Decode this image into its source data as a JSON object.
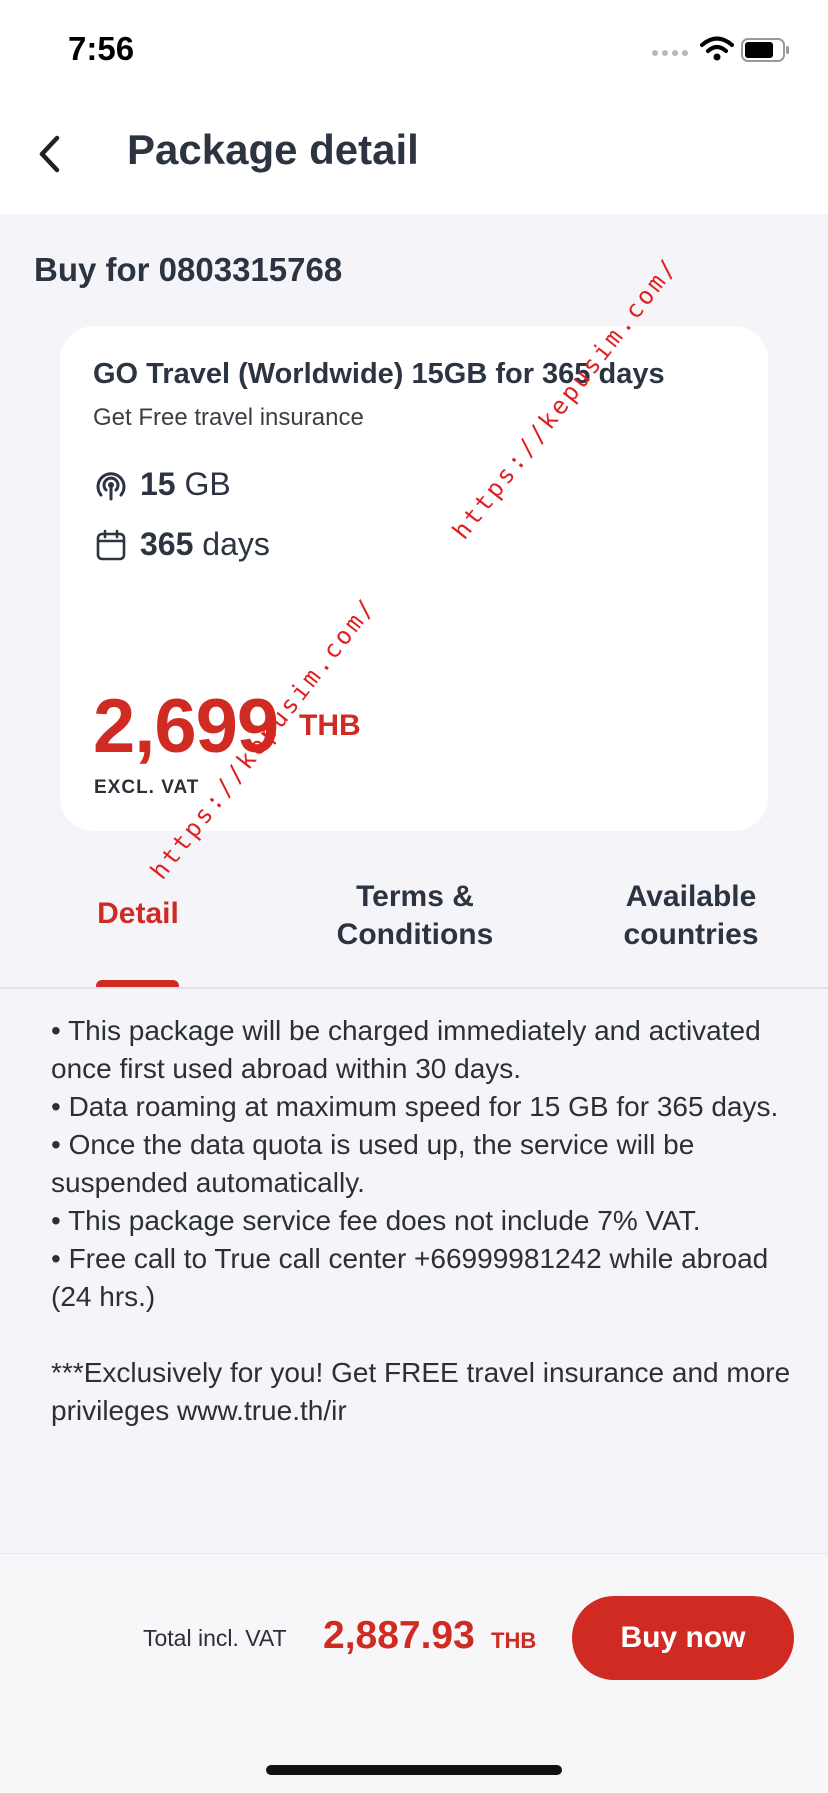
{
  "status_bar": {
    "time": "7:56"
  },
  "header": {
    "title": "Package detail"
  },
  "buy_for": "Buy for 0803315768",
  "package": {
    "name": "GO Travel (Worldwide) 15GB for 365 days",
    "subtitle": "Get Free travel insurance",
    "data_value": "15",
    "data_unit": "GB",
    "days_value": "365",
    "days_unit": "days",
    "price": "2,699",
    "currency": "THB",
    "vat_note": "EXCL. VAT"
  },
  "tabs": [
    {
      "label": "Detail",
      "active": true
    },
    {
      "label_line1": "Terms &",
      "label_line2": "Conditions",
      "active": false
    },
    {
      "label_line1": "Available",
      "label_line2": "countries",
      "active": false
    }
  ],
  "detail": {
    "lines": [
      "• This package will be charged immediately and activated once first used abroad within 30 days.",
      "• Data roaming at maximum speed for 15 GB for 365 days.",
      "• Once the data quota is used up, the service will be suspended automatically.",
      "• This package service fee does not include 7% VAT.",
      "• Free call to True call center +66999981242 while abroad (24 hrs.)"
    ],
    "note": "***Exclusively for you! Get FREE travel insurance and more privileges www.true.th/ir"
  },
  "watermark": "https://kepusim.com/",
  "footer": {
    "total_label": "Total incl. VAT",
    "total_value": "2,887.93",
    "total_currency": "THB",
    "buy_button": "Buy now"
  },
  "colors": {
    "accent": "#d02b22",
    "background": "#f5f5f9",
    "card": "#ffffff"
  },
  "icons": [
    "chevron-left-icon",
    "wifi-icon",
    "battery-icon",
    "data-signal-icon",
    "calendar-icon"
  ]
}
